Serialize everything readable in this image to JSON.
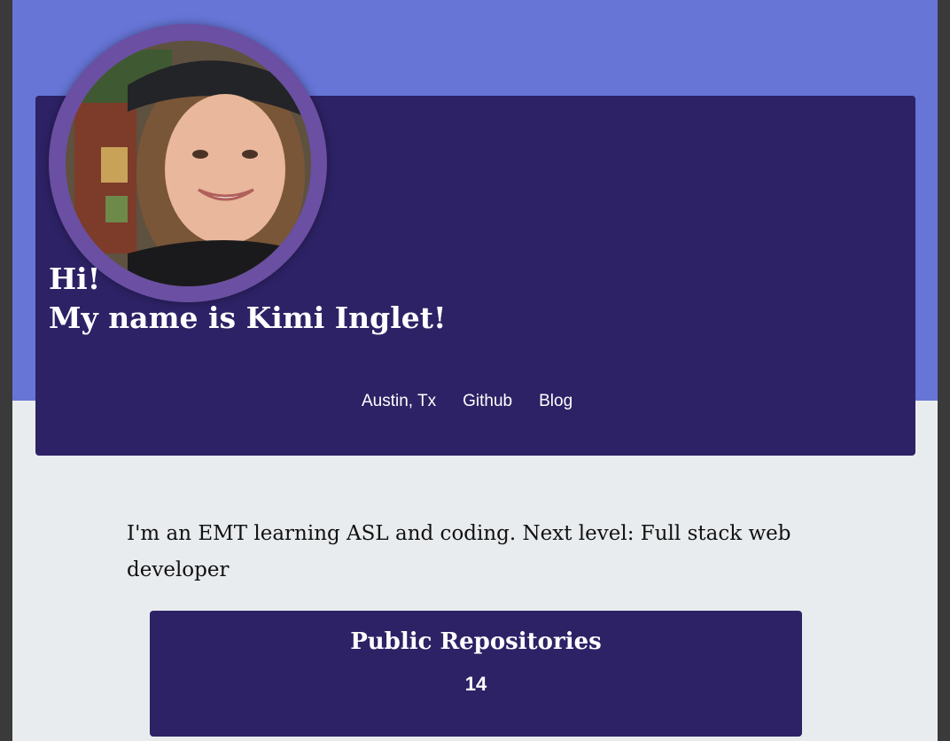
{
  "header": {
    "greeting_line1": "Hi!",
    "greeting_line2": "My name is Kimi Inglet!",
    "links": [
      "Austin, Tx",
      "Github",
      "Blog"
    ]
  },
  "bio": "I'm an EMT learning ASL and coding. Next level: Full stack web developer",
  "stats": {
    "title": "Public Repositories",
    "value": "14"
  },
  "colors": {
    "top_band": "#6675d6",
    "card": "#2d2265",
    "avatar_ring": "#6a4fa3",
    "page_bg": "#e9ecee"
  }
}
